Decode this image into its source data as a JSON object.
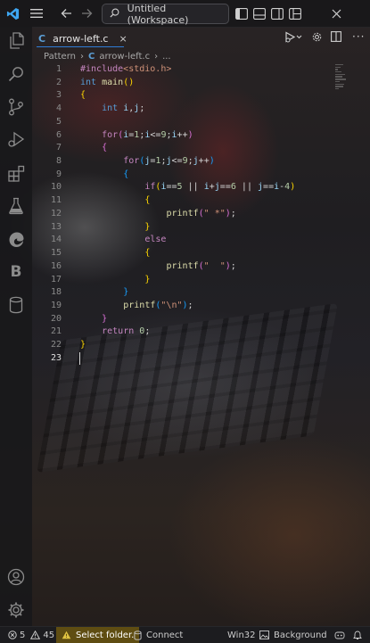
{
  "titlebar": {
    "search_text": "Untitled (Workspace)",
    "icons": [
      "vscode-logo",
      "menu-icon",
      "back-arrow-icon",
      "forward-arrow-icon",
      "search-icon",
      "toggle-primary-sidebar-icon",
      "toggle-panel-icon",
      "toggle-secondary-sidebar-icon",
      "customize-layout-icon",
      "close-icon"
    ]
  },
  "activity_bar": {
    "items": [
      "explorer-icon",
      "search-icon",
      "source-control-icon",
      "run-debug-icon",
      "extensions-icon",
      "testing-icon",
      "edge-devtools-icon",
      "bootstrap-icon",
      "database-icon"
    ],
    "bottom": [
      "accounts-icon",
      "manage-icon"
    ],
    "bootstrap_letter": "B"
  },
  "tab": {
    "icon_text": "C",
    "label": "arrow-left.c",
    "close": "×"
  },
  "breadcrumb": {
    "folder": "Pattern",
    "sep1": "›",
    "icon_text": "C",
    "file": "arrow-left.c",
    "sep2": "›",
    "more": "..."
  },
  "code_lines": [
    {
      "n": "1",
      "text": "#include<stdio.h>"
    },
    {
      "n": "2",
      "text": "int main()"
    },
    {
      "n": "3",
      "text": "{"
    },
    {
      "n": "4",
      "text": "    int i,j;"
    },
    {
      "n": "5",
      "text": ""
    },
    {
      "n": "6",
      "text": "    for(i=1;i<=9;i++)"
    },
    {
      "n": "7",
      "text": "    {"
    },
    {
      "n": "8",
      "text": "        for(j=1;j<=9;j++)"
    },
    {
      "n": "9",
      "text": "        {"
    },
    {
      "n": "10",
      "text": "            if(i==5 || i+j==6 || j==i-4)"
    },
    {
      "n": "11",
      "text": "            {"
    },
    {
      "n": "12",
      "text": "                printf(\" *\");"
    },
    {
      "n": "13",
      "text": "            }"
    },
    {
      "n": "14",
      "text": "            else"
    },
    {
      "n": "15",
      "text": "            {"
    },
    {
      "n": "16",
      "text": "                printf(\"  \");"
    },
    {
      "n": "17",
      "text": "            }"
    },
    {
      "n": "18",
      "text": "        }"
    },
    {
      "n": "19",
      "text": "        printf(\"\\n\");"
    },
    {
      "n": "20",
      "text": "    }"
    },
    {
      "n": "21",
      "text": "    return 0;"
    },
    {
      "n": "22",
      "text": "}"
    },
    {
      "n": "23",
      "text": ""
    }
  ],
  "active_line": "23",
  "statusbar": {
    "errors": "5",
    "warnings": "45",
    "select_folder": "Select folder.",
    "connect": "Connect",
    "platform": "Win32",
    "background": "Background"
  },
  "colors": {
    "accent": "#2f7cd6",
    "keyword": "#569cd6",
    "string": "#ce9178",
    "function": "#dcdcaa",
    "variable": "#9cdcfe",
    "number": "#b5cea8"
  }
}
